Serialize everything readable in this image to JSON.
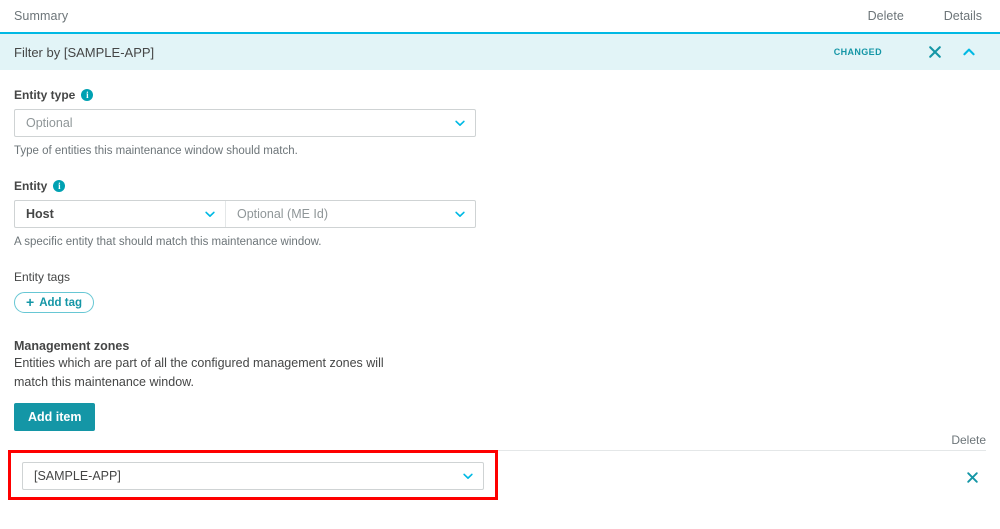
{
  "topbar": {
    "title": "Summary",
    "actions": [
      {
        "label": "Delete",
        "name": "delete"
      },
      {
        "label": "Details",
        "name": "details"
      }
    ]
  },
  "filter_bar": {
    "title": "Filter by [SAMPLE-APP]",
    "badge": "CHANGED",
    "close_icon": "close-x-icon",
    "collapse_icon": "chevron-up-icon",
    "accent_color": "#00b9e4",
    "background_color": "#e2f4f7"
  },
  "form": {
    "entity_type": {
      "label": "Entity type",
      "info_icon": "info-circle-icon",
      "value": "Optional",
      "is_placeholder": true,
      "helper": "Type of entities this maintenance window should match.",
      "chevron_icon": "chevron-down-icon"
    },
    "entity": {
      "label": "Entity",
      "info_icon": "info-circle-icon",
      "type_value": "Host",
      "id_value": "Optional (ME Id)",
      "id_is_placeholder": true,
      "helper": "A specific entity that should match this maintenance window.",
      "chevron_icon": "chevron-down-icon"
    },
    "entity_tags": {
      "label": "Entity tags",
      "add_tag_label": "Add tag",
      "plus_icon": "plus-icon"
    },
    "management_zones": {
      "title": "Management zones",
      "description": "Entities which are part of all the configured management zones will match this maintenance window.",
      "add_item_label": "Add item"
    }
  },
  "zone_list": {
    "delete_column_label": "Delete",
    "rows": [
      {
        "value": "[SAMPLE-APP]",
        "chevron_icon": "chevron-down-icon",
        "delete_icon": "close-x-icon"
      }
    ]
  },
  "annotation": {
    "highlight_color": "#fe0000"
  },
  "theme": {
    "accent": "#1496a6",
    "accent_light": "#00b9e4",
    "text": "#454646",
    "muted": "#6d7579",
    "placeholder": "#8f9698",
    "border": "#cfd3d4"
  }
}
